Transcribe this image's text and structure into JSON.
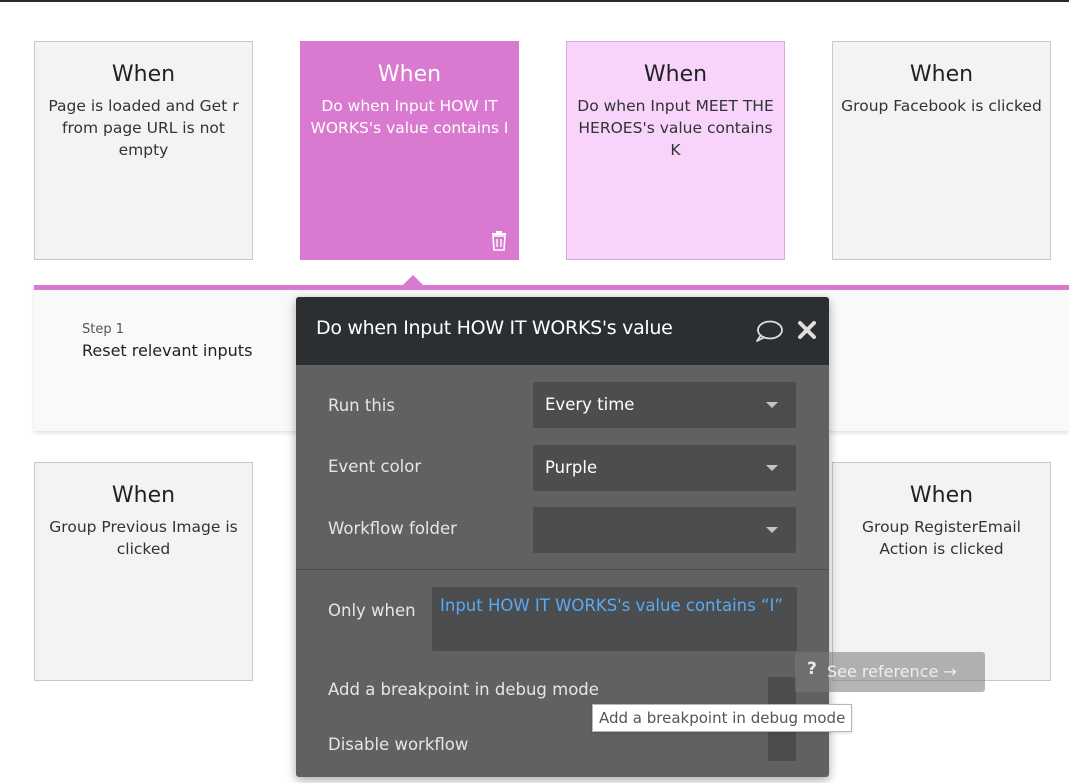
{
  "cards_top": [
    {
      "when": "When",
      "desc": "Page is loaded and Get r from page URL is not empty"
    },
    {
      "when": "When",
      "desc": "Do when Input HOW IT WORKS's value contains I"
    },
    {
      "when": "When",
      "desc": "Do when Input MEET THE HEROES's value contains K"
    },
    {
      "when": "When",
      "desc": "Group Facebook is clicked"
    }
  ],
  "cards_bottom": [
    {
      "when": "When",
      "desc": "Group Previous Image is clicked"
    },
    {
      "when": "When",
      "desc": "Group RegisterEmail Action is clicked"
    }
  ],
  "colors": {
    "selected": "#d97ad0",
    "pink": "#f8d4fb",
    "panel": "#5f6163",
    "link": "#5aa9f7"
  },
  "step": {
    "label": "Step 1",
    "name": "Reset relevant inputs"
  },
  "panel": {
    "title": "Do when Input HOW IT WORKS's value contains I",
    "run_this": {
      "label": "Run this",
      "value": "Every time"
    },
    "event_color": {
      "label": "Event color",
      "value": "Purple"
    },
    "workflow_folder": {
      "label": "Workflow folder",
      "value": ""
    },
    "only_when": {
      "label": "Only when",
      "value": "Input HOW IT WORKS's value contains “I”"
    },
    "breakpoint": {
      "label": "Add a breakpoint in debug mode"
    },
    "disable": {
      "label": "Disable workflow"
    }
  },
  "see_reference": {
    "q": "?",
    "label": "See reference →"
  },
  "tooltip": {
    "text": "Add a breakpoint in debug mode"
  },
  "icons": {
    "trash": "trash-icon",
    "comment": "comment-icon",
    "close": "close-icon"
  }
}
